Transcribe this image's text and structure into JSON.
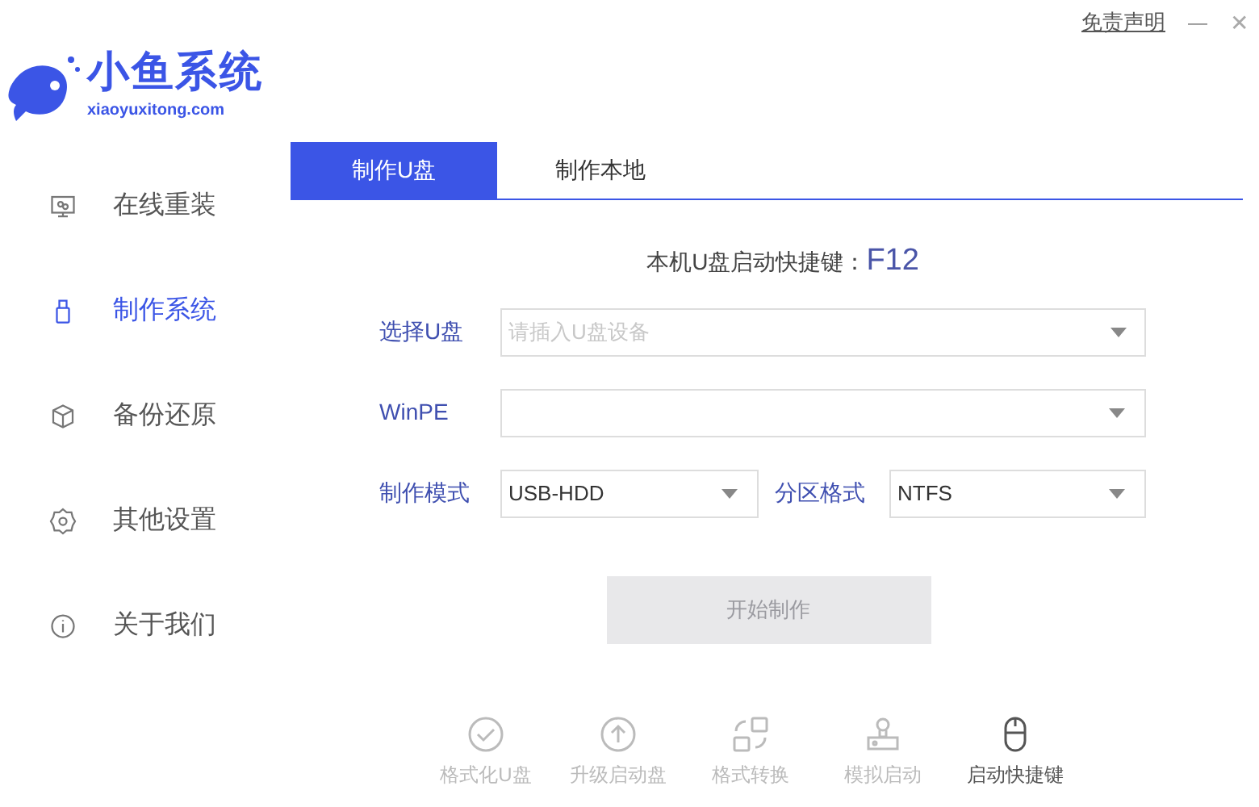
{
  "logo": {
    "name": "小鱼系统",
    "domain": "xiaoyuxitong.com"
  },
  "top_bar": {
    "disclaimer": "免责声明",
    "minimize": "—",
    "close": "✕"
  },
  "sidebar": {
    "items": [
      {
        "label": "在线重装",
        "selected": false
      },
      {
        "label": "制作系统",
        "selected": true
      },
      {
        "label": "备份还原",
        "selected": false
      },
      {
        "label": "其他设置",
        "selected": false
      },
      {
        "label": "关于我们",
        "selected": false
      }
    ]
  },
  "tabs": [
    {
      "label": "制作U盘",
      "selected": true
    },
    {
      "label": "制作本地",
      "selected": false
    }
  ],
  "hotkey": {
    "label": "本机U盘启动快捷键：",
    "value": "F12"
  },
  "form": {
    "usb": {
      "label": "选择U盘",
      "placeholder": "请插入U盘设备"
    },
    "winpe": {
      "label": "WinPE"
    },
    "mode": {
      "label": "制作模式",
      "value": "USB-HDD"
    },
    "partition": {
      "label": "分区格式",
      "value": "NTFS"
    }
  },
  "start_button": {
    "label": "开始制作",
    "disabled": true
  },
  "tools": [
    {
      "label": "格式化U盘",
      "selected": false
    },
    {
      "label": "升级启动盘",
      "selected": false
    },
    {
      "label": "格式转换",
      "selected": false
    },
    {
      "label": "模拟启动",
      "selected": false
    },
    {
      "label": "启动快捷键",
      "selected": true
    }
  ]
}
